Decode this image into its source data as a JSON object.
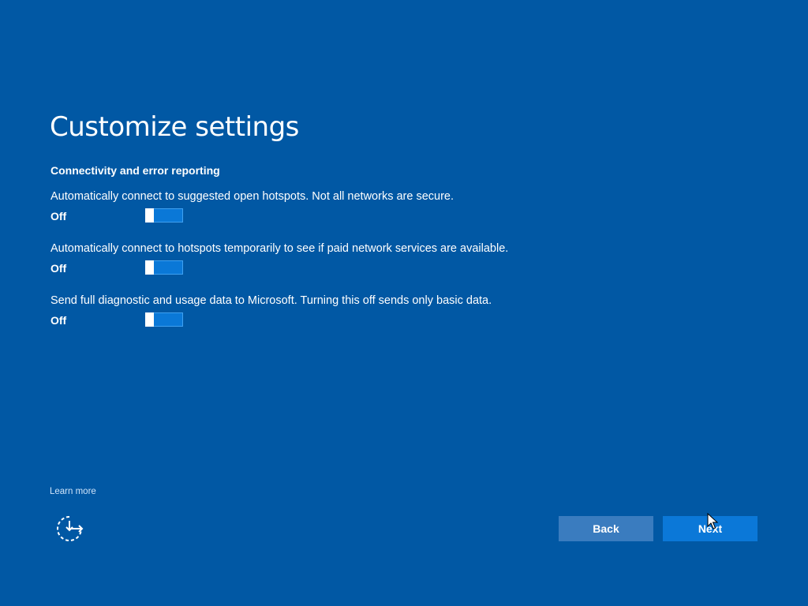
{
  "header": {
    "title": "Customize settings"
  },
  "section": {
    "heading": "Connectivity and error reporting"
  },
  "settings": [
    {
      "description": "Automatically connect to suggested open hotspots. Not all networks are secure.",
      "state_label": "Off",
      "enabled": false
    },
    {
      "description": "Automatically connect to hotspots temporarily to see if paid network services are available.",
      "state_label": "Off",
      "enabled": false
    },
    {
      "description": "Send full diagnostic and usage data to Microsoft. Turning this off sends only basic data.",
      "state_label": "Off",
      "enabled": false
    }
  ],
  "footer": {
    "learn_more": "Learn more",
    "ease_of_access_icon": "ease-of-access-icon",
    "back_label": "Back",
    "next_label": "Next"
  },
  "colors": {
    "background": "#0158a4",
    "toggle_track": "#0a78d7",
    "back_button": "#3a7cbf",
    "next_button": "#0b78d8",
    "text": "#ffffff"
  }
}
